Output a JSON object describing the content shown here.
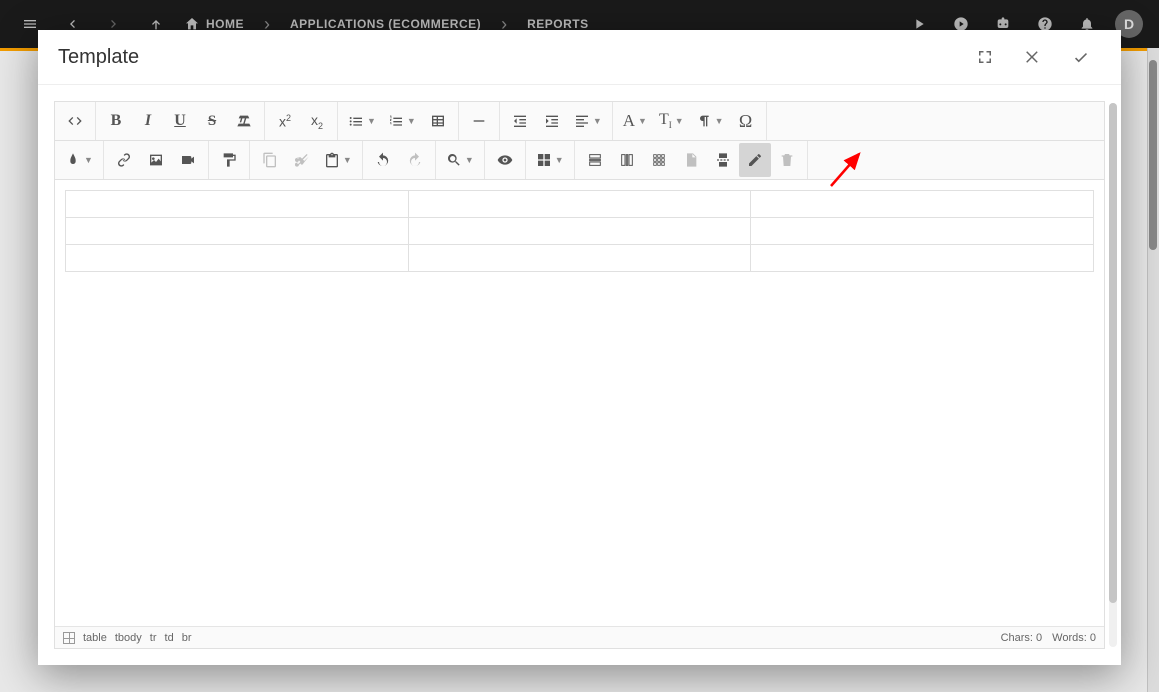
{
  "header": {
    "breadcrumbs": [
      "HOME",
      "APPLICATIONS (ECOMMERCE)",
      "REPORTS"
    ],
    "avatar_initial": "D"
  },
  "modal": {
    "title": "Template"
  },
  "toolbar": {
    "bold": "B",
    "italic": "I",
    "underline": "U",
    "strike": "S",
    "superscript_base": "x",
    "superscript_exp": "2",
    "subscript_base": "x",
    "subscript_sub": "2",
    "font_a": "A",
    "omega": "Ω",
    "tI": "T",
    "tI_sub": "I"
  },
  "statusbar": {
    "crumbs": [
      "table",
      "tbody",
      "tr",
      "td",
      "br"
    ],
    "chars_label": "Chars:",
    "chars_value": "0",
    "words_label": "Words:",
    "words_value": "0"
  }
}
